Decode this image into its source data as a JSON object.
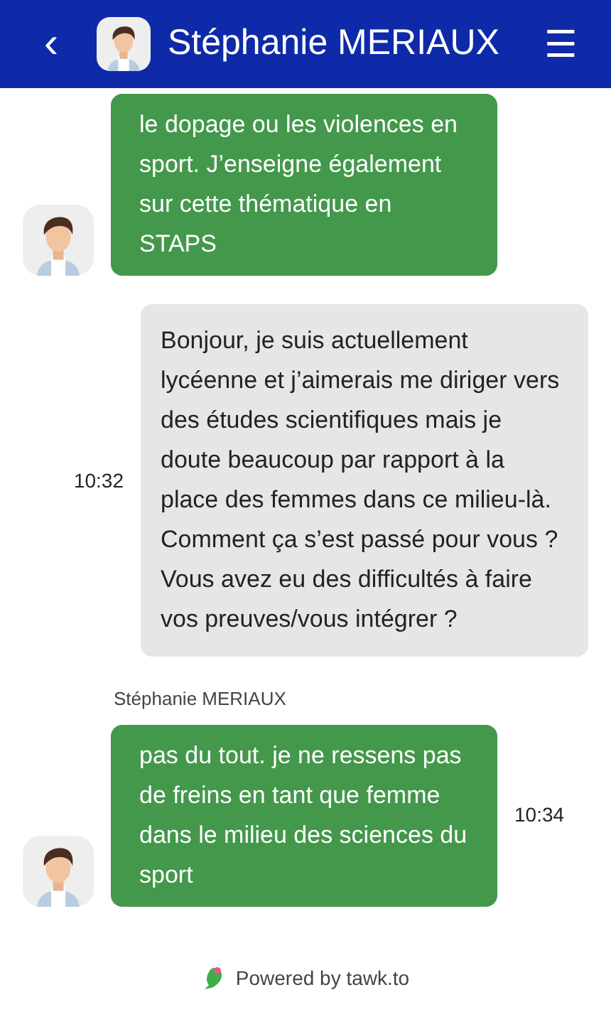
{
  "header": {
    "back": "‹",
    "title": "Stéphanie MERIAUX",
    "menu": "☰"
  },
  "messages": [
    {
      "kind": "agent",
      "text": "le dopage ou les violences en sport. J’enseigne également sur cette thématique en STAPS"
    },
    {
      "kind": "visitor",
      "time": "10:32",
      "text": "Bonjour, je suis actuellement lycéenne et j’aimerais me diriger vers des études scientifiques mais je doute beaucoup par rapport à la place des femmes dans ce milieu-là. Comment ça s’est passé pour vous ? Vous avez eu des difficultés à faire vos preuves/vous intégrer ?"
    },
    {
      "kind": "agent",
      "sender": "Stéphanie MERIAUX",
      "time": "10:34",
      "text": "pas du tout. je ne ressens pas de freins en tant que femme dans le milieu des sciences du sport"
    }
  ],
  "footer": "Powered by tawk.to"
}
